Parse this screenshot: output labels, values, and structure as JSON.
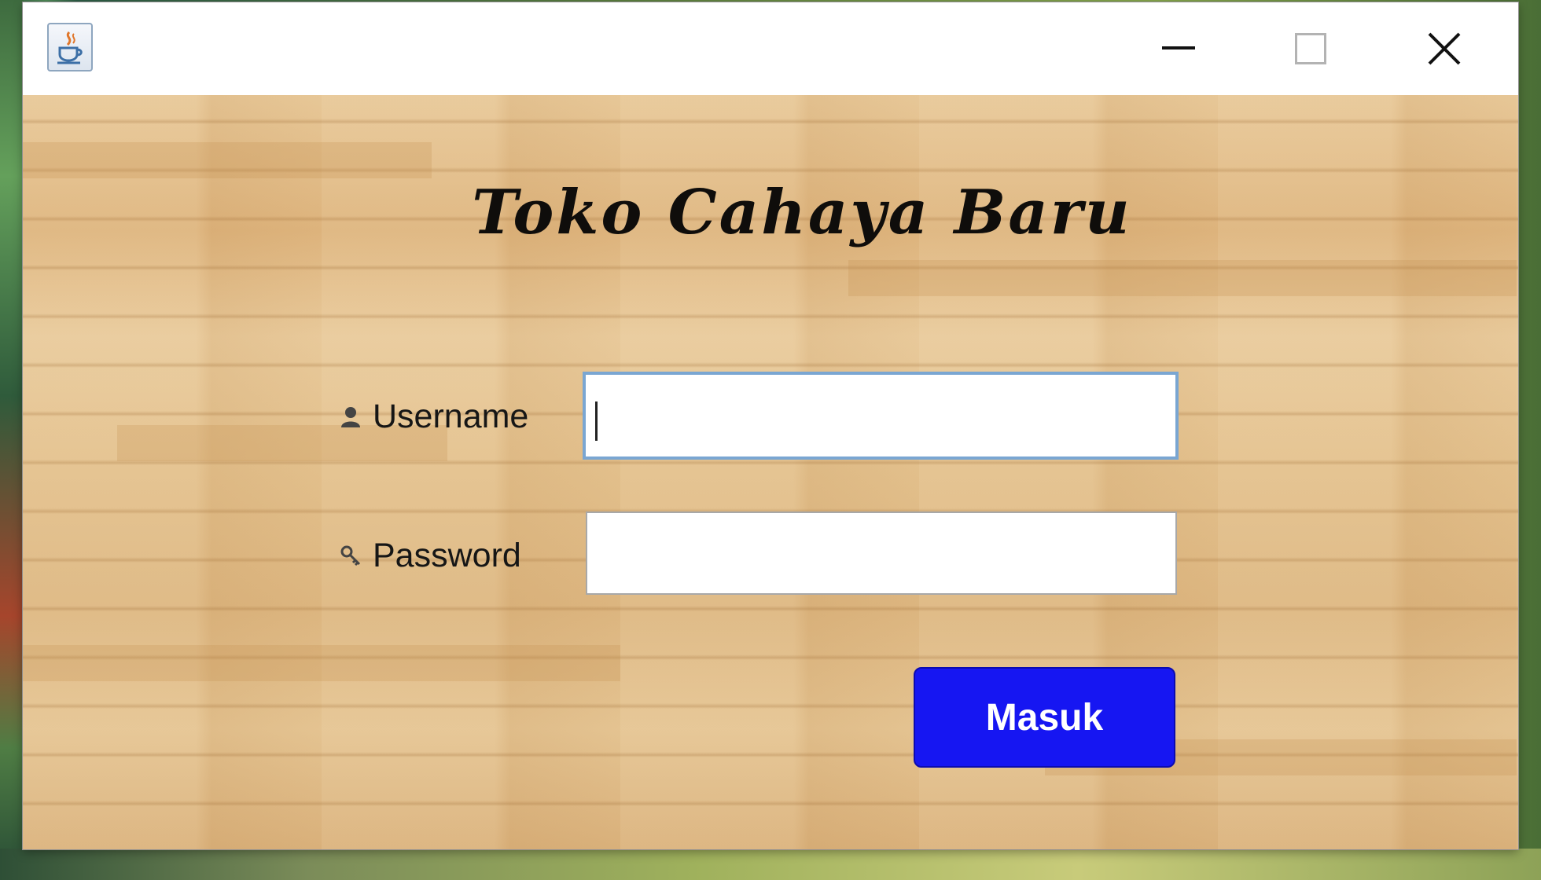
{
  "window": {
    "title": "",
    "icon": "java-coffee-cup-icon",
    "controls": {
      "minimize": "minimize-icon",
      "maximize": "maximize-icon",
      "close": "close-icon"
    }
  },
  "login": {
    "heading": "Toko Cahaya Baru",
    "username": {
      "label": "Username",
      "icon": "user-icon",
      "value": ""
    },
    "password": {
      "label": "Password",
      "icon": "key-icon",
      "value": ""
    },
    "submit_label": "Masuk"
  },
  "colors": {
    "button_bg": "#1616f2",
    "button_text": "#ffffff",
    "focused_field_border": "#7aa6d2",
    "background_wood": "#ddb37c"
  }
}
